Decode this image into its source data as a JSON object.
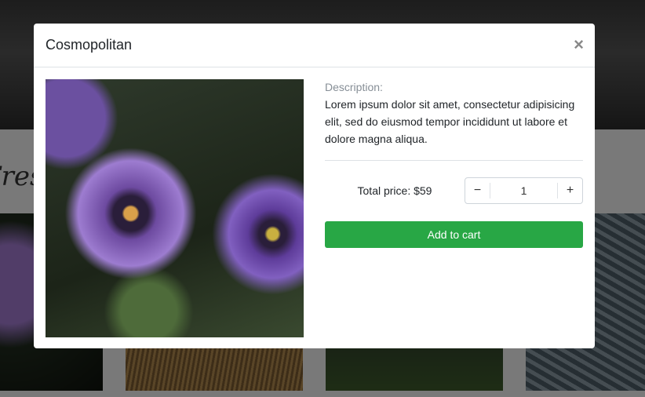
{
  "background": {
    "section_heading": "Fresh"
  },
  "modal": {
    "title": "Cosmopolitan",
    "close_icon": "×",
    "description_label": "Description:",
    "description": "Lorem ipsum dolor sit amet, consectetur adipisicing elit, sed do eiusmod tempor incididunt ut labore et dolore magna aliqua.",
    "total_price": "Total price: $59",
    "quantity": {
      "minus": "−",
      "value": "1",
      "plus": "+"
    },
    "add_to_cart": "Add to cart"
  },
  "colors": {
    "accent": "#28a745"
  }
}
